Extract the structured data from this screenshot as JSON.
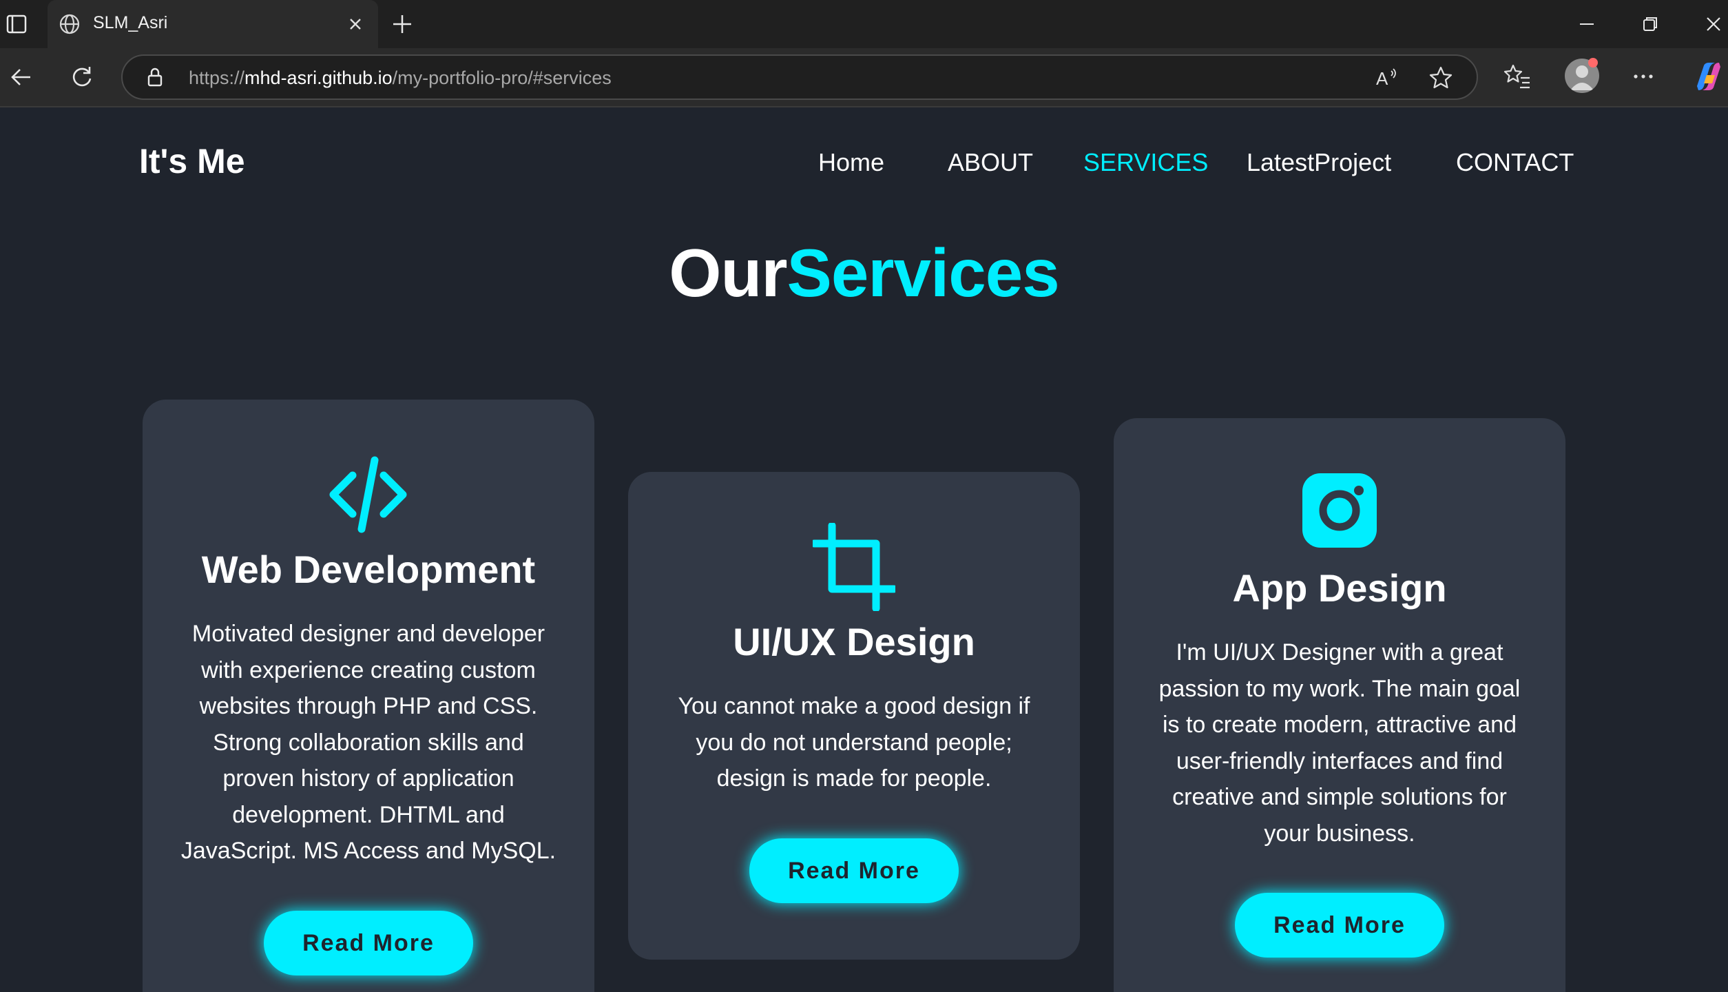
{
  "browser": {
    "tab_title": "SLM_Asri",
    "url_scheme": "https://",
    "url_host": "mhd-asri.github.io",
    "url_path": "/my-portfolio-pro/#services",
    "icons": [
      "tab-actions-icon",
      "globe-icon",
      "close-icon",
      "plus-icon",
      "minimize-icon",
      "restore-icon",
      "close-window-icon",
      "back-icon",
      "refresh-icon",
      "lock-icon",
      "read-aloud-icon",
      "star-icon",
      "favorites-icon",
      "profile-icon",
      "more-icon",
      "copilot-icon"
    ]
  },
  "header": {
    "logo": "It's Me",
    "nav": [
      "Home",
      "ABOUT",
      "SERVICES",
      "LatestProject",
      "CONTACT"
    ],
    "active_nav": "SERVICES"
  },
  "services": {
    "heading_plain": "Our",
    "heading_accent": "Services",
    "cards": [
      {
        "icon": "code-icon",
        "title": "Web Development",
        "lines": [
          "Motivated designer and developer",
          "with experience creating custom",
          "websites through PHP and CSS.",
          "Strong collaboration skills and",
          "proven history of application",
          "development. DHTML and",
          "JavaScript. MS Access and MySQL."
        ],
        "button": "Read More"
      },
      {
        "icon": "crop-icon",
        "title": "UI/UX Design",
        "lines": [
          "You cannot make a good design if",
          "you do not understand people;",
          "design is made for people."
        ],
        "button": "Read More"
      },
      {
        "icon": "instagram-icon",
        "title": "App Design",
        "lines": [
          "I'm UI/UX Designer with a great",
          "passion to my work. The main goal",
          "is to create modern, attractive and",
          "user-friendly interfaces and find",
          "creative and simple solutions for",
          "your business."
        ],
        "button": "Read More"
      }
    ]
  },
  "colors": {
    "accent": "#00eeff",
    "background": "#1f242d",
    "card": "#323946"
  }
}
